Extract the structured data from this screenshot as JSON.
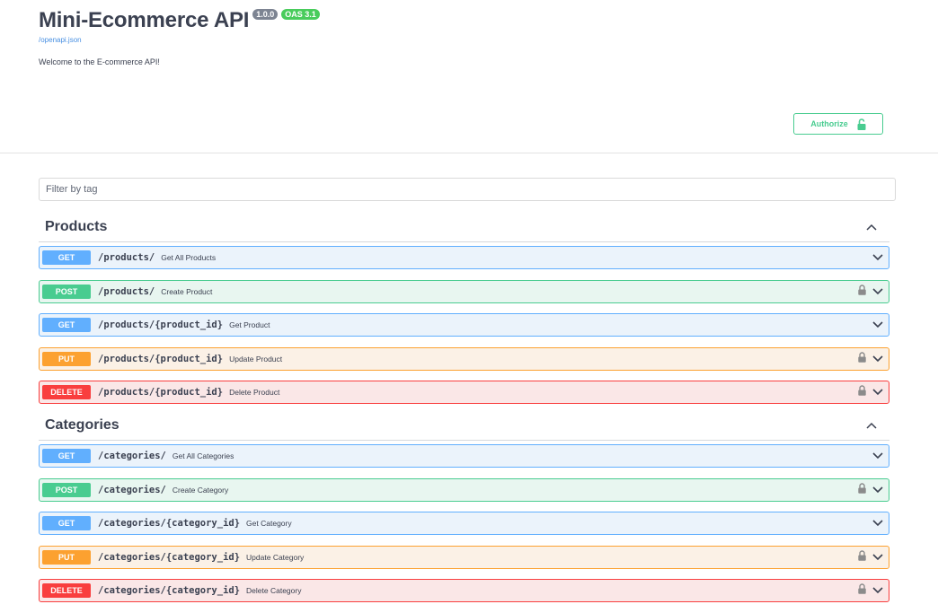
{
  "info": {
    "title": "Mini-Ecommerce API",
    "version": "1.0.0",
    "oas": "OAS 3.1",
    "spec_link": "/openapi.json",
    "description": "Welcome to the E-commerce API!"
  },
  "authorize": {
    "label": "Authorize"
  },
  "filter": {
    "placeholder": "Filter by tag"
  },
  "colors": {
    "get": "#61affe",
    "post": "#49cc90",
    "put": "#fca130",
    "delete": "#f93e3e"
  },
  "tags": [
    {
      "name": "Products",
      "operations": [
        {
          "method": "GET",
          "path": "/products/",
          "summary": "Get All Products",
          "locked": false
        },
        {
          "method": "POST",
          "path": "/products/",
          "summary": "Create Product",
          "locked": true
        },
        {
          "method": "GET",
          "path": "/products/{product_id}",
          "summary": "Get Product",
          "locked": false
        },
        {
          "method": "PUT",
          "path": "/products/{product_id}",
          "summary": "Update Product",
          "locked": true
        },
        {
          "method": "DELETE",
          "path": "/products/{product_id}",
          "summary": "Delete Product",
          "locked": true
        }
      ]
    },
    {
      "name": "Categories",
      "operations": [
        {
          "method": "GET",
          "path": "/categories/",
          "summary": "Get All Categories",
          "locked": false
        },
        {
          "method": "POST",
          "path": "/categories/",
          "summary": "Create Category",
          "locked": true
        },
        {
          "method": "GET",
          "path": "/categories/{category_id}",
          "summary": "Get Category",
          "locked": false
        },
        {
          "method": "PUT",
          "path": "/categories/{category_id}",
          "summary": "Update Category",
          "locked": true
        },
        {
          "method": "DELETE",
          "path": "/categories/{category_id}",
          "summary": "Delete Category",
          "locked": true
        }
      ]
    }
  ]
}
